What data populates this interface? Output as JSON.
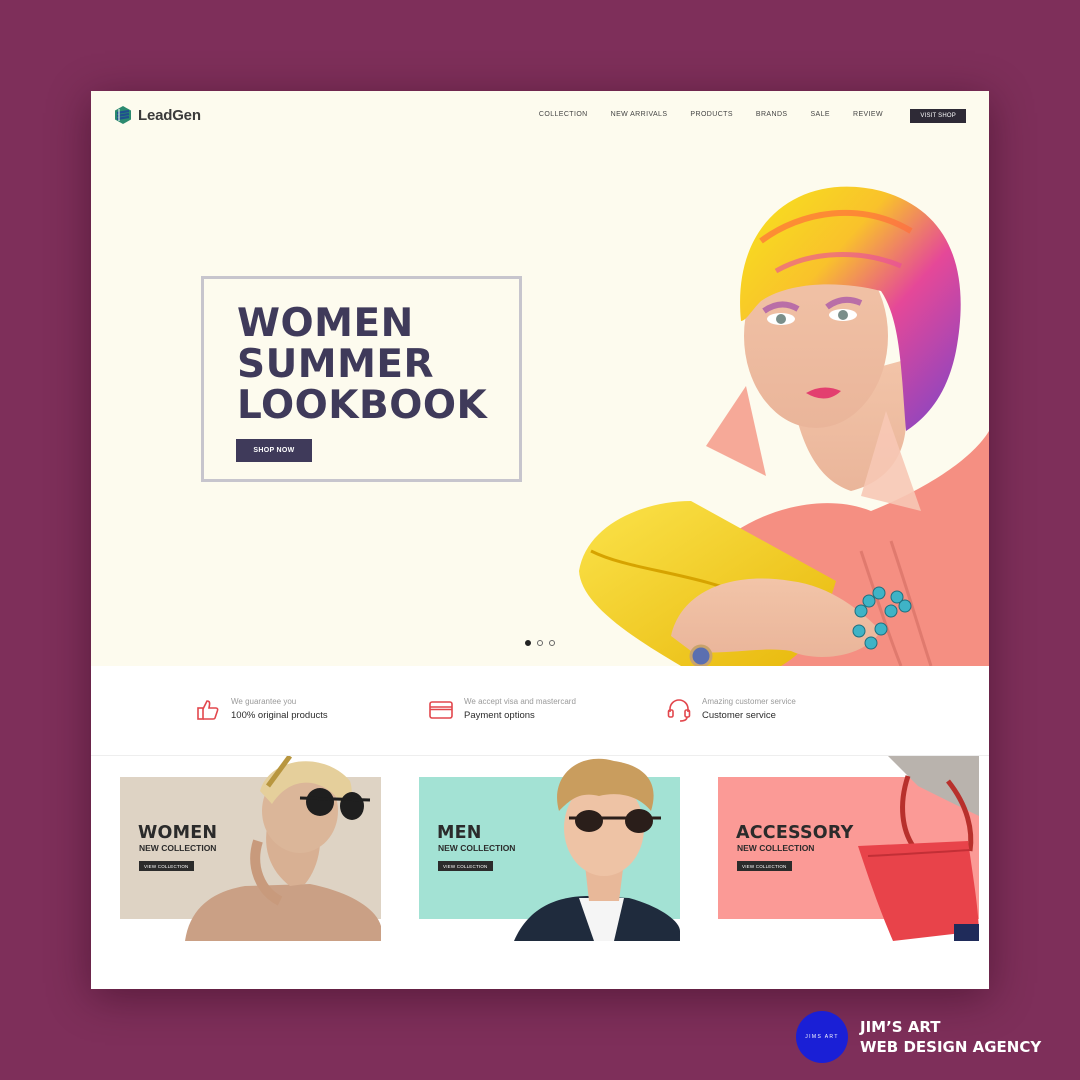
{
  "brand": {
    "name": "LeadGen"
  },
  "nav": {
    "items": [
      "COLLECTION",
      "NEW ARRIVALS",
      "PRODUCTS",
      "BRANDS",
      "SALE",
      "REVIEW"
    ],
    "cta": "VISIT SHOP"
  },
  "hero": {
    "headline": [
      "WOMEN",
      "SUMMER",
      "LOOKBOOK"
    ],
    "button": "SHOP NOW",
    "slides": {
      "count": 3,
      "active": 1
    }
  },
  "features": [
    {
      "icon": "thumbs-up-icon",
      "small": "We guarantee you",
      "big": "100% original products"
    },
    {
      "icon": "credit-card-icon",
      "small": "We accept visa and mastercard",
      "big": "Payment options"
    },
    {
      "icon": "headset-icon",
      "small": "Amazing customer service",
      "big": "Customer service"
    }
  ],
  "categories": [
    {
      "title": "WOMEN",
      "subtitle": "NEW COLLECTION",
      "button": "VIEW COLLECTION",
      "bg": "#ded3c4"
    },
    {
      "title": "MEN",
      "subtitle": "NEW COLLECTION",
      "button": "VIEW COLLECTION",
      "bg": "#a3e2d4"
    },
    {
      "title": "ACCESSORY",
      "subtitle": "NEW COLLECTION",
      "button": "VIEW COLLECTION",
      "bg": "#fb9a96"
    }
  ],
  "agency": {
    "badge": "JIMS ART",
    "line1": "JIM’S ART",
    "line2": "WEB DESIGN AGENCY"
  },
  "colors": {
    "background": "#7e2f5a",
    "hero_bg": "#fdfbee",
    "headline": "#3f3a5a",
    "feature_icon": "#e2474d",
    "dark_button": "#2e2a36",
    "agency_blue": "#1a1fd6"
  }
}
